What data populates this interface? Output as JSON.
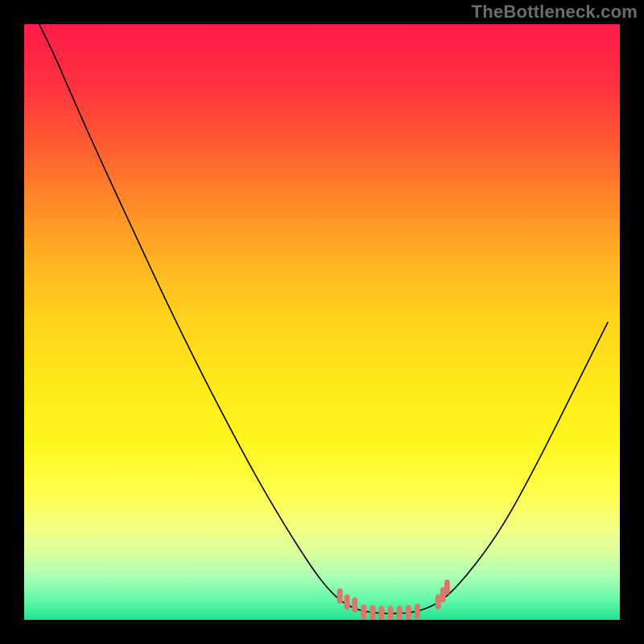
{
  "watermark": "TheBottleneck.com",
  "chart_data": {
    "type": "line",
    "title": "",
    "xlabel": "",
    "ylabel": "",
    "xlim": [
      0,
      100
    ],
    "ylim": [
      0,
      100
    ],
    "background_gradient": {
      "stops": [
        {
          "offset": 0.0,
          "color": "#ff1a4a"
        },
        {
          "offset": 0.1,
          "color": "#ff3140"
        },
        {
          "offset": 0.2,
          "color": "#ff5a30"
        },
        {
          "offset": 0.3,
          "color": "#ff8a28"
        },
        {
          "offset": 0.4,
          "color": "#ffb423"
        },
        {
          "offset": 0.5,
          "color": "#ffd41c"
        },
        {
          "offset": 0.6,
          "color": "#ffe81a"
        },
        {
          "offset": 0.7,
          "color": "#fff61e"
        },
        {
          "offset": 0.78,
          "color": "#ffff47"
        },
        {
          "offset": 0.84,
          "color": "#f6ff7d"
        },
        {
          "offset": 0.89,
          "color": "#d7ffa0"
        },
        {
          "offset": 0.93,
          "color": "#a6ffb6"
        },
        {
          "offset": 0.97,
          "color": "#5cf7a9"
        },
        {
          "offset": 1.0,
          "color": "#22e38c"
        }
      ]
    },
    "series": [
      {
        "name": "curve",
        "color": "#000000",
        "data": [
          {
            "x": 2.5,
            "y": 100.0
          },
          {
            "x": 5.0,
            "y": 95.0
          },
          {
            "x": 8.0,
            "y": 88.0
          },
          {
            "x": 12.0,
            "y": 79.0
          },
          {
            "x": 18.0,
            "y": 66.0
          },
          {
            "x": 25.0,
            "y": 51.0
          },
          {
            "x": 32.0,
            "y": 37.0
          },
          {
            "x": 40.0,
            "y": 22.0
          },
          {
            "x": 48.0,
            "y": 9.0
          },
          {
            "x": 52.0,
            "y": 4.0
          },
          {
            "x": 55.0,
            "y": 2.0
          },
          {
            "x": 58.0,
            "y": 1.2
          },
          {
            "x": 62.0,
            "y": 1.0
          },
          {
            "x": 66.0,
            "y": 1.3
          },
          {
            "x": 70.0,
            "y": 3.0
          },
          {
            "x": 74.0,
            "y": 7.0
          },
          {
            "x": 80.0,
            "y": 15.0
          },
          {
            "x": 86.0,
            "y": 26.0
          },
          {
            "x": 92.0,
            "y": 38.0
          },
          {
            "x": 98.0,
            "y": 50.0
          }
        ]
      }
    ],
    "annotations": [
      {
        "name": "left-tick-cluster",
        "color": "#d9786b",
        "marks": [
          {
            "x": 53.0,
            "y": 4.0
          },
          {
            "x": 54.2,
            "y": 3.0
          },
          {
            "x": 55.5,
            "y": 2.5
          }
        ]
      },
      {
        "name": "bottom-dot-cluster",
        "color": "#d9786b",
        "marks": [
          {
            "x": 57.0,
            "y": 1.3
          },
          {
            "x": 58.5,
            "y": 1.2
          },
          {
            "x": 60.0,
            "y": 1.1
          },
          {
            "x": 61.5,
            "y": 1.1
          },
          {
            "x": 63.0,
            "y": 1.1
          },
          {
            "x": 64.5,
            "y": 1.2
          },
          {
            "x": 66.0,
            "y": 1.4
          }
        ]
      },
      {
        "name": "right-tick-cluster",
        "color": "#d9786b",
        "marks": [
          {
            "x": 69.5,
            "y": 3.0
          },
          {
            "x": 70.3,
            "y": 4.2
          },
          {
            "x": 71.0,
            "y": 5.5
          }
        ]
      }
    ]
  }
}
